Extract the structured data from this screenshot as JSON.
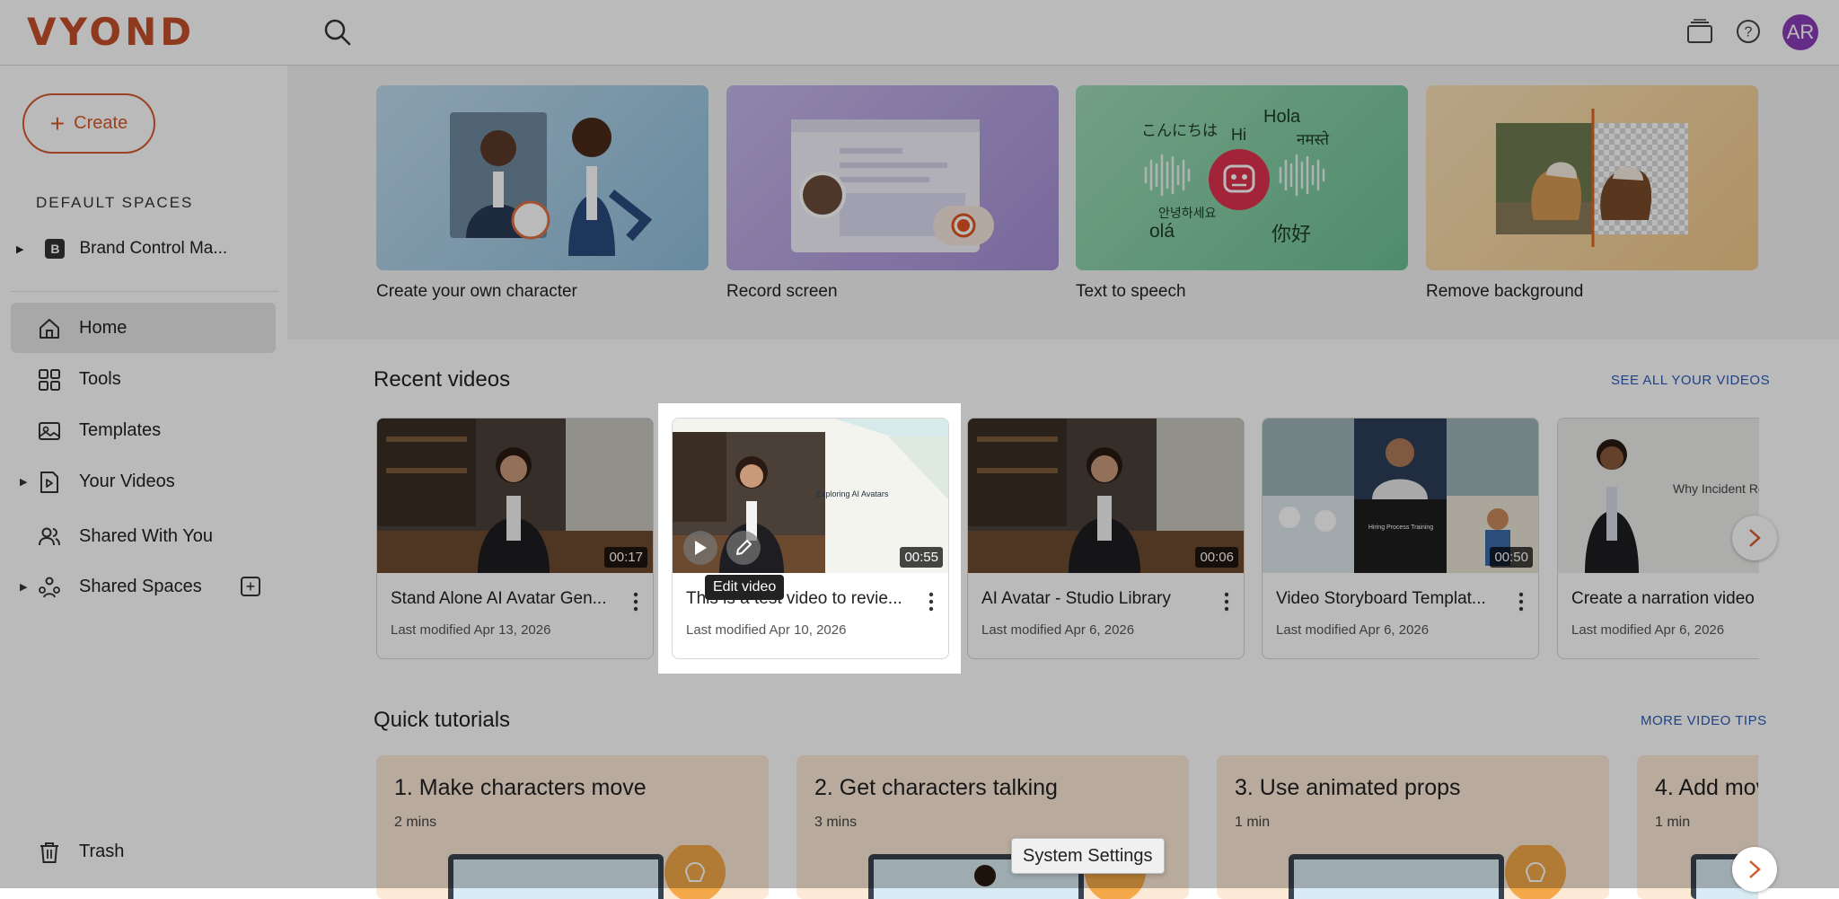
{
  "app": {
    "logo": "VYOND"
  },
  "header": {
    "avatar_initials": "AR"
  },
  "sidebar": {
    "create_label": "Create",
    "spaces_header": "DEFAULT SPACES",
    "space_badge": "B",
    "space_item": "Brand Control Ma...",
    "nav": {
      "home": "Home",
      "tools": "Tools",
      "templates": "Templates",
      "your_videos": "Your Videos",
      "shared_with_you": "Shared With You",
      "shared_spaces": "Shared Spaces",
      "trash": "Trash"
    }
  },
  "tools": [
    {
      "label": "Create your own character"
    },
    {
      "label": "Record screen"
    },
    {
      "label": "Text to speech",
      "greetings": [
        "こんにちは",
        "Hi",
        "Hola",
        "नमस्ते",
        "안녕하세요",
        "olá",
        "你好"
      ]
    },
    {
      "label": "Remove background"
    }
  ],
  "recent": {
    "title": "Recent videos",
    "see_all": "SEE ALL YOUR VIDEOS",
    "videos": [
      {
        "title": "Stand Alone AI Avatar Gen...",
        "date": "Last modified Apr 13, 2026",
        "duration": "00:17"
      },
      {
        "title": "This is a test video to revie...",
        "date": "Last modified Apr 10, 2026",
        "duration": "00:55",
        "thumb_text": "Exploring AI Avatars"
      },
      {
        "title": "AI Avatar - Studio Library",
        "date": "Last modified Apr 6, 2026",
        "duration": "00:06"
      },
      {
        "title": "Video Storyboard Templat...",
        "date": "Last modified Apr 6, 2026",
        "duration": "00:50",
        "thumb_text": "Hiring Process Training"
      },
      {
        "title": "Create a narration video",
        "date": "Last modified Apr 6, 2026",
        "thumb_text": "Why Incident Response Matte"
      }
    ],
    "edit_tooltip": "Edit video"
  },
  "tutorials": {
    "title": "Quick tutorials",
    "more": "MORE VIDEO TIPS",
    "items": [
      {
        "title": "1. Make characters move",
        "duration": "2 mins"
      },
      {
        "title": "2. Get characters talking",
        "duration": "3 mins"
      },
      {
        "title": "3. Use animated props",
        "duration": "1 min"
      },
      {
        "title": "4. Add mov",
        "duration": "1 min"
      }
    ]
  },
  "system_tooltip": "System Settings"
}
